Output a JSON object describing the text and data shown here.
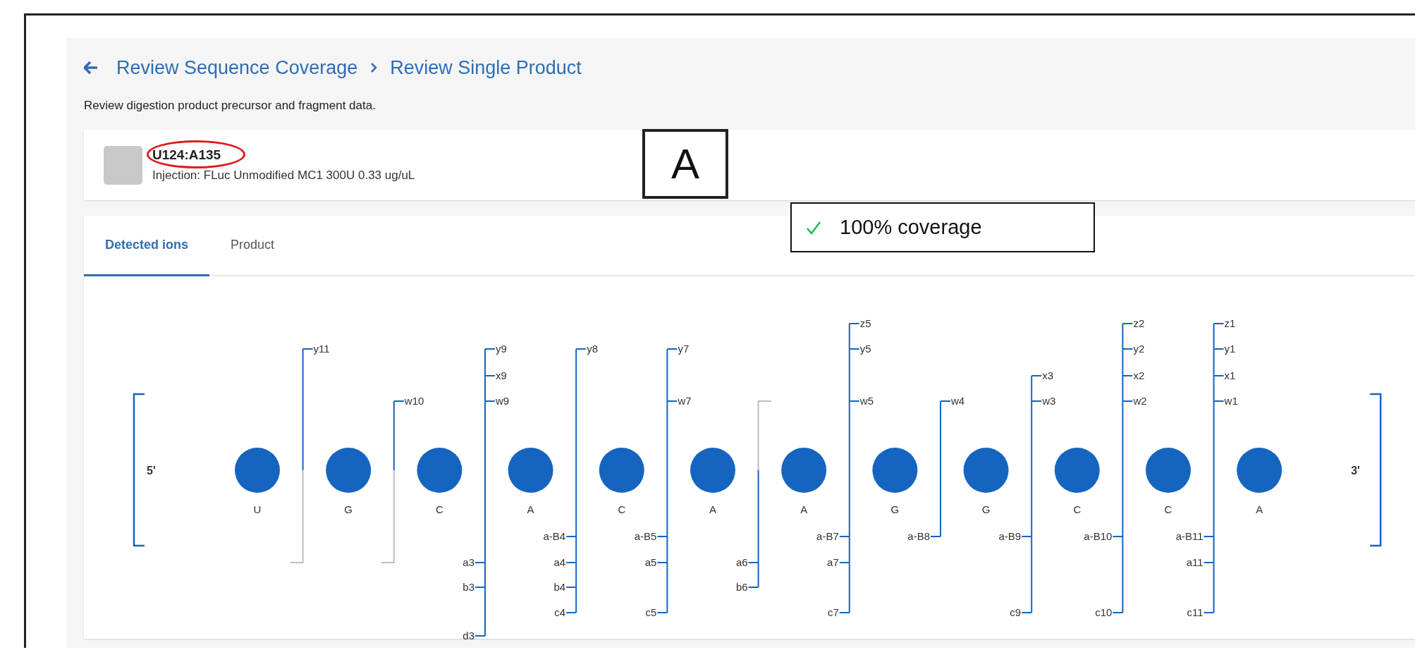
{
  "breadcrumb": [
    {
      "label": "Review Sequence Coverage"
    },
    {
      "label": "Review Single Product"
    }
  ],
  "description": "Review digestion product precursor and fragment data.",
  "product": {
    "title": "U124:A135",
    "subtitle": "Injection: FLuc Unmodified MC1 300U 0.33 ug/uL"
  },
  "tabs": [
    {
      "label": "Detected ions",
      "selected": true
    },
    {
      "label": "Product",
      "selected": false
    }
  ],
  "sequence": {
    "five_prime": "5'",
    "three_prime": "3'",
    "nucleotides": [
      "U",
      "G",
      "C",
      "A",
      "C",
      "A",
      "A",
      "G",
      "G",
      "C",
      "C",
      "A"
    ],
    "cleavages": [
      {
        "top": {
          "y": "y11"
        }
      },
      {
        "top": {
          "w": "w10"
        }
      },
      {
        "top": {
          "y": "y9",
          "x": "x9",
          "w": "w9"
        },
        "bottom": {
          "a": "a3",
          "b": "b3",
          "d": "d3"
        }
      },
      {
        "top": {
          "y": "y8"
        },
        "bottom": {
          "a-B": "a-B4",
          "a": "a4",
          "b": "b4",
          "c": "c4"
        }
      },
      {
        "top": {
          "y": "y7",
          "w": "w7"
        },
        "bottom": {
          "a-B": "a-B5",
          "a": "a5",
          "c": "c5"
        }
      },
      {
        "bottom": {
          "a": "a6",
          "b": "b6"
        }
      },
      {
        "top": {
          "z": "z5",
          "y": "y5",
          "w": "w5"
        },
        "bottom": {
          "a-B": "a-B7",
          "a": "a7",
          "c": "c7"
        }
      },
      {
        "top": {
          "w": "w4"
        },
        "bottom": {
          "a-B": "a-B8"
        }
      },
      {
        "top": {
          "x": "x3",
          "w": "w3"
        },
        "bottom": {
          "a-B": "a-B9",
          "c": "c9"
        }
      },
      {
        "top": {
          "z": "z2",
          "y": "y2",
          "x": "x2",
          "w": "w2"
        },
        "bottom": {
          "a-B": "a-B10",
          "c": "c10"
        }
      },
      {
        "top": {
          "z": "z1",
          "y": "y1",
          "x": "x1",
          "w": "w1"
        },
        "bottom": {
          "a-B": "a-B11",
          "a": "a11",
          "c": "c11"
        }
      }
    ]
  },
  "annotations": {
    "panel_label": "A",
    "coverage": "100% coverage"
  }
}
